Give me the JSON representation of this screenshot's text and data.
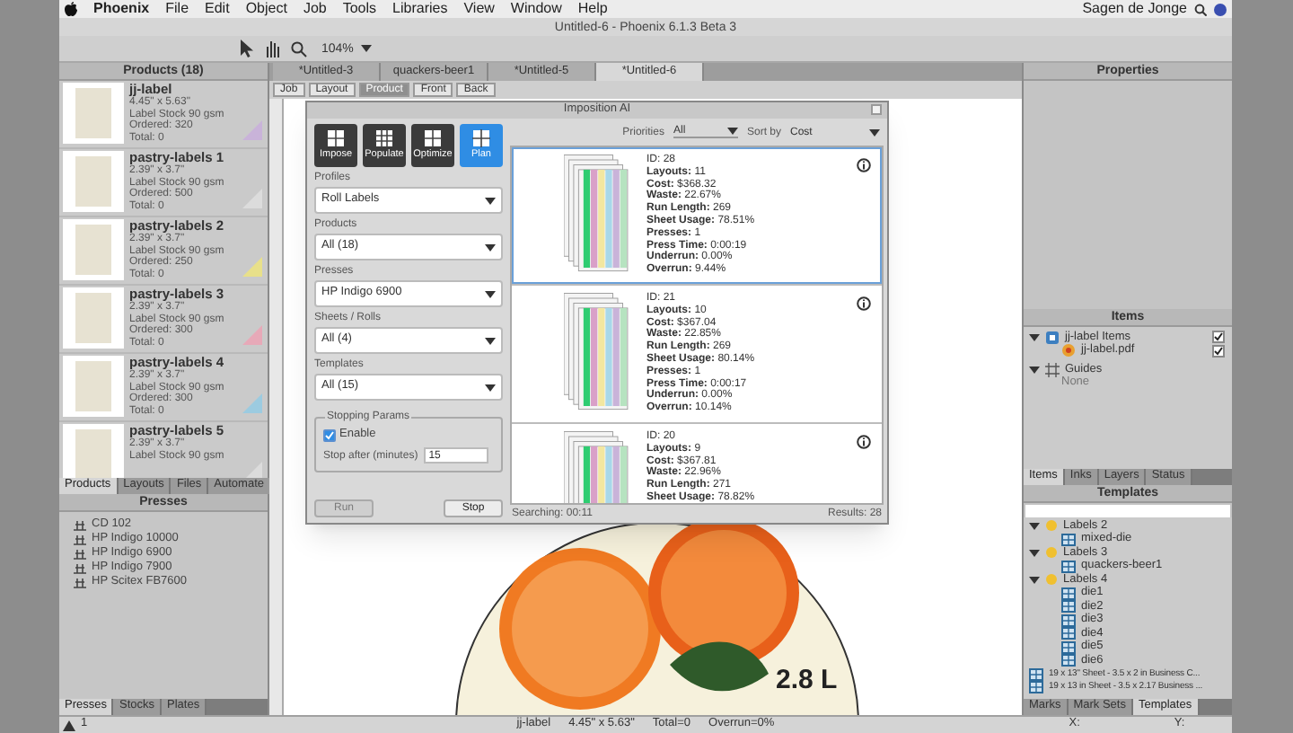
{
  "menu_bar": {
    "items": [
      "Phoenix",
      "File",
      "Edit",
      "Object",
      "Job",
      "Tools",
      "Libraries",
      "View",
      "Window",
      "Help"
    ],
    "user": "Sagen de Jonge"
  },
  "window": {
    "title": "Untitled-6 - Phoenix 6.1.3 Beta 3"
  },
  "toolbar": {
    "zoom": "104%"
  },
  "products_panel": {
    "title": "Products (18)",
    "items": [
      {
        "name": "jj-label",
        "size": "4.45\" x 5.63\"",
        "stock": "Label Stock 90 gsm",
        "ordered": "Ordered: 320",
        "total": "Total: 0",
        "color": "#c9b3d9"
      },
      {
        "name": "pastry-labels 1",
        "size": "2.39\" x 3.7\"",
        "stock": "Label Stock 90 gsm",
        "ordered": "Ordered: 500",
        "total": "Total: 0",
        "color": "#dcdcdc"
      },
      {
        "name": "pastry-labels 2",
        "size": "2.39\" x 3.7\"",
        "stock": "Label Stock 90 gsm",
        "ordered": "Ordered: 250",
        "total": "Total: 0",
        "color": "#e8e08a"
      },
      {
        "name": "pastry-labels 3",
        "size": "2.39\" x 3.7\"",
        "stock": "Label Stock 90 gsm",
        "ordered": "Ordered: 300",
        "total": "Total: 0",
        "color": "#e7a9b8"
      },
      {
        "name": "pastry-labels 4",
        "size": "2.39\" x 3.7\"",
        "stock": "Label Stock 90 gsm",
        "ordered": "Ordered: 300",
        "total": "Total: 0",
        "color": "#9ccbe0"
      },
      {
        "name": "pastry-labels 5",
        "size": "2.39\" x 3.7\"",
        "stock": "Label Stock 90 gsm",
        "color": "#dcdcdc"
      }
    ],
    "tabs": [
      {
        "label": "Products",
        "selected": true
      },
      {
        "label": "Layouts",
        "selected": false
      },
      {
        "label": "Files",
        "selected": false
      },
      {
        "label": "Automate",
        "selected": false
      }
    ]
  },
  "presses_panel": {
    "title": "Presses",
    "items": [
      "CD 102",
      "HP Indigo 10000",
      "HP Indigo 6900",
      "HP Indigo 7900",
      "HP Scitex FB7600"
    ],
    "tabs": [
      {
        "label": "Presses",
        "selected": true
      },
      {
        "label": "Stocks",
        "selected": false
      },
      {
        "label": "Plates",
        "selected": false
      }
    ]
  },
  "document_tabs": [
    {
      "label": "*Untitled-3",
      "selected": false
    },
    {
      "label": "quackers-beer1",
      "selected": false
    },
    {
      "label": "*Untitled-5",
      "selected": false
    },
    {
      "label": "*Untitled-6",
      "selected": true
    }
  ],
  "view_buttons": [
    {
      "label": "Job",
      "selected": false
    },
    {
      "label": "Layout",
      "selected": false
    },
    {
      "label": "Product",
      "selected": true
    },
    {
      "label": "Front",
      "selected": false
    },
    {
      "label": "Back",
      "selected": false
    }
  ],
  "canvas": {
    "label_text": "2.8 L"
  },
  "dialog": {
    "title": "Imposition AI",
    "modes": [
      {
        "label": "Impose",
        "selected": false
      },
      {
        "label": "Populate",
        "selected": false
      },
      {
        "label": "Optimize",
        "selected": false
      },
      {
        "label": "Plan",
        "selected": true
      }
    ],
    "fields": [
      {
        "label": "Profiles",
        "value": "Roll Labels"
      },
      {
        "label": "Products",
        "value": "All (18)"
      },
      {
        "label": "Presses",
        "value": "HP Indigo 6900"
      },
      {
        "label": "Sheets / Rolls",
        "value": "All (4)"
      },
      {
        "label": "Templates",
        "value": "All (15)"
      }
    ],
    "stopping": {
      "title": "Stopping Params",
      "enable_label": "Enable",
      "enabled": true,
      "stop_label": "Stop after (minutes)",
      "stop_value": "15"
    },
    "buttons": [
      {
        "label": "Run",
        "disabled": true
      },
      {
        "label": "Stop",
        "disabled": false
      }
    ],
    "priorities_label": "Priorities",
    "priorities_value": "All",
    "sort_label": "Sort by",
    "sort_value": "Cost",
    "results": [
      {
        "selected": true,
        "lines": [
          {
            "label": "ID:",
            "value": "28"
          },
          {
            "label": "Layouts:",
            "value": "11"
          },
          {
            "label": "Cost:",
            "value": "$368.32"
          },
          {
            "label": "Waste:",
            "value": "22.67%"
          },
          {
            "label": "Run Length:",
            "value": "269"
          },
          {
            "label": "Sheet Usage:",
            "value": "78.51%"
          },
          {
            "label": "Presses:",
            "value": "1"
          },
          {
            "label": "Press Time:",
            "value": "0:00:19"
          },
          {
            "label": "Underrun:",
            "value": "0.00%"
          },
          {
            "label": "Overrun:",
            "value": "9.44%"
          }
        ]
      },
      {
        "selected": false,
        "lines": [
          {
            "label": "ID:",
            "value": "21"
          },
          {
            "label": "Layouts:",
            "value": "10"
          },
          {
            "label": "Cost:",
            "value": "$367.04"
          },
          {
            "label": "Waste:",
            "value": "22.85%"
          },
          {
            "label": "Run Length:",
            "value": "269"
          },
          {
            "label": "Sheet Usage:",
            "value": "80.14%"
          },
          {
            "label": "Presses:",
            "value": "1"
          },
          {
            "label": "Press Time:",
            "value": "0:00:17"
          },
          {
            "label": "Underrun:",
            "value": "0.00%"
          },
          {
            "label": "Overrun:",
            "value": "10.14%"
          }
        ]
      },
      {
        "selected": false,
        "lines": [
          {
            "label": "ID:",
            "value": "20"
          },
          {
            "label": "Layouts:",
            "value": "9"
          },
          {
            "label": "Cost:",
            "value": "$367.81"
          },
          {
            "label": "Waste:",
            "value": "22.96%"
          },
          {
            "label": "Run Length:",
            "value": "271"
          },
          {
            "label": "Sheet Usage:",
            "value": "78.82%"
          }
        ]
      }
    ],
    "searching": "Searching: 00:11",
    "results_count": "Results: 28"
  },
  "properties_panel": {
    "title": "Properties"
  },
  "items_panel": {
    "title": "Items",
    "tree": [
      {
        "label": "jj-label Items",
        "kind": "layer",
        "checked": true,
        "expanded": true,
        "children": [
          {
            "label": "jj-label.pdf",
            "kind": "file",
            "checked": true
          }
        ]
      },
      {
        "label": "Guides",
        "kind": "guides",
        "expanded": true,
        "children": [
          {
            "label": "None",
            "kind": "note"
          }
        ]
      }
    ],
    "tabs": [
      {
        "label": "Items",
        "selected": true
      },
      {
        "label": "Inks",
        "selected": false
      },
      {
        "label": "Layers",
        "selected": false
      },
      {
        "label": "Status",
        "selected": false
      }
    ]
  },
  "templates_panel": {
    "title": "Templates",
    "tree": [
      {
        "label": "Labels 2",
        "kind": "group",
        "expanded": true,
        "children": [
          {
            "label": "mixed-die",
            "kind": "die"
          }
        ]
      },
      {
        "label": "Labels 3",
        "kind": "group",
        "expanded": true,
        "children": [
          {
            "label": "quackers-beer1",
            "kind": "die"
          }
        ]
      },
      {
        "label": "Labels 4",
        "kind": "group",
        "expanded": true,
        "children": [
          {
            "label": "die1",
            "kind": "die"
          },
          {
            "label": "die2",
            "kind": "die"
          },
          {
            "label": "die3",
            "kind": "die"
          },
          {
            "label": "die4",
            "kind": "die"
          },
          {
            "label": "die5",
            "kind": "die"
          },
          {
            "label": "die6",
            "kind": "die"
          }
        ]
      },
      {
        "label": "19 x 13\" Sheet - 3.5 x 2 in Business C...",
        "kind": "die"
      },
      {
        "label": "19 x 13 in Sheet - 3.5 x 2.17 Business ...",
        "kind": "die"
      }
    ],
    "tabs": [
      {
        "label": "Marks",
        "selected": false
      },
      {
        "label": "Mark Sets",
        "selected": false
      },
      {
        "label": "Templates",
        "selected": true
      }
    ]
  },
  "status_bar": {
    "warning_count": "1",
    "fields": [
      "jj-label",
      "4.45\" x 5.63\"",
      "Total=0",
      "Overrun=0%"
    ],
    "x_label": "X:",
    "y_label": "Y:"
  }
}
